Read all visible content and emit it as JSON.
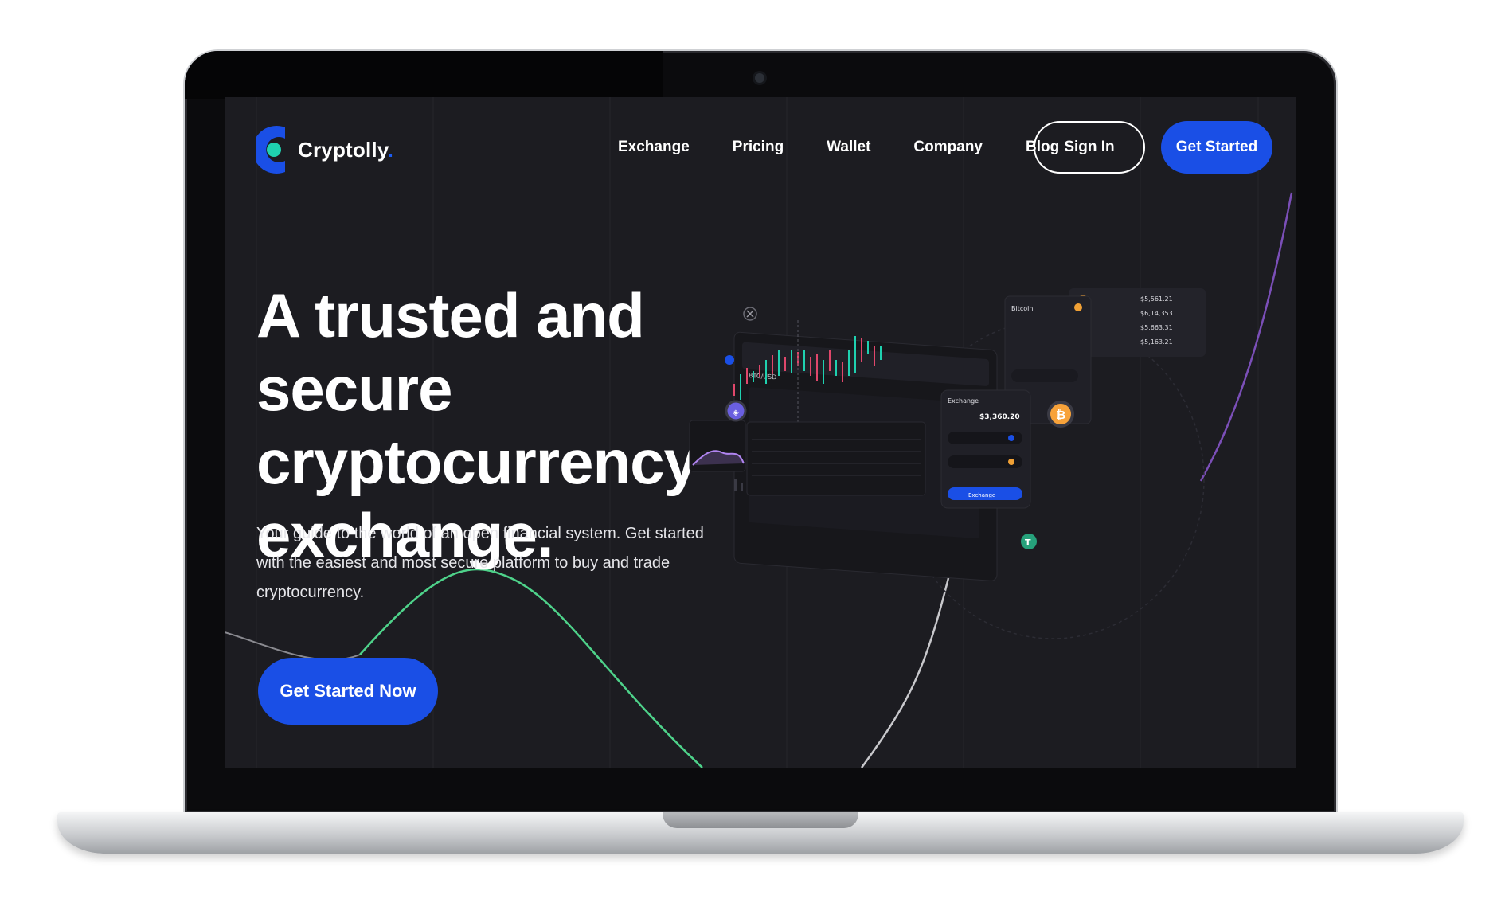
{
  "brand": {
    "name": "Cryptolly",
    "dot": ".",
    "accent_color": "#1a4fe6",
    "logo_inner_color": "#1fd1b0"
  },
  "nav": {
    "links": [
      "Exchange",
      "Pricing",
      "Wallet",
      "Company",
      "Blog"
    ],
    "sign_in": "Sign In",
    "get_started": "Get Started"
  },
  "hero": {
    "title": "A trusted and secure cryptocurrency exchange.",
    "subtitle": "Your guide to the world of an open financial system. Get started with the easiest and most secure platform to buy and trade cryptocurrency.",
    "cta": "Get Started Now"
  },
  "dashboard_preview": {
    "exchange_title": "Exchange",
    "exchange_amount": "$3,360.20",
    "exchange_button": "Exchange",
    "pair": "BTC/USD",
    "side_title": "Bitcoin",
    "price_list": [
      "$5,561.21",
      "$6,14,353",
      "$5,663.31",
      "$5,163.21"
    ]
  },
  "icons": [
    "bitcoin-icon",
    "tether-icon",
    "ethereum-icon",
    "dollar-icon",
    "close-icon"
  ]
}
